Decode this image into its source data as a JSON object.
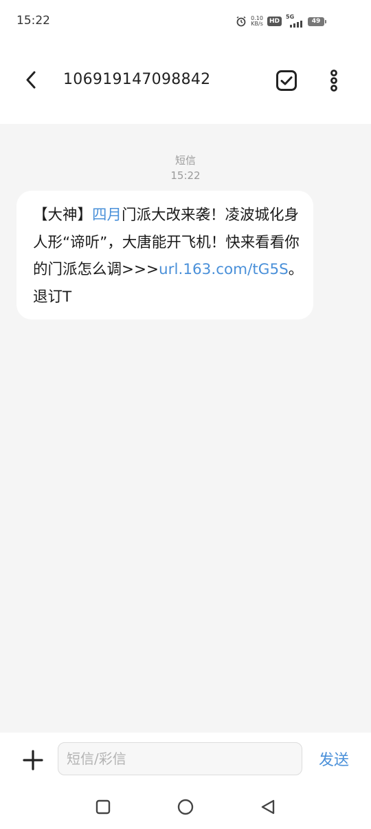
{
  "status_bar": {
    "time": "15:22",
    "net_speed_value": "0.10",
    "net_speed_unit": "KB/s",
    "hd_label": "HD",
    "network_type": "5G",
    "battery_level": "49"
  },
  "header": {
    "title": "106919147098842"
  },
  "conversation": {
    "message_type": "短信",
    "message_time": "15:22",
    "message": {
      "part1": "【大神】",
      "link1": "四月",
      "part2": "门派大改来袭！凌波城化身人形“谛听”，大唐能开飞机！快来看看你的门派怎么调>>>",
      "link2": "url.163.com/tG5S",
      "part3": "。 退订T"
    }
  },
  "input_bar": {
    "placeholder": "短信/彩信",
    "send_label": "发送"
  },
  "icons": {
    "back": "chevron-left-icon",
    "select": "checkbox-checked-icon",
    "more": "more-vertical-icon",
    "add": "plus-icon",
    "nav_recent": "square-icon",
    "nav_home": "circle-icon",
    "nav_back": "triangle-back-icon"
  },
  "colors": {
    "link": "#4a90d9",
    "send": "#4a90d9",
    "conversation_bg": "#f5f5f5",
    "bubble_bg": "#ffffff"
  }
}
